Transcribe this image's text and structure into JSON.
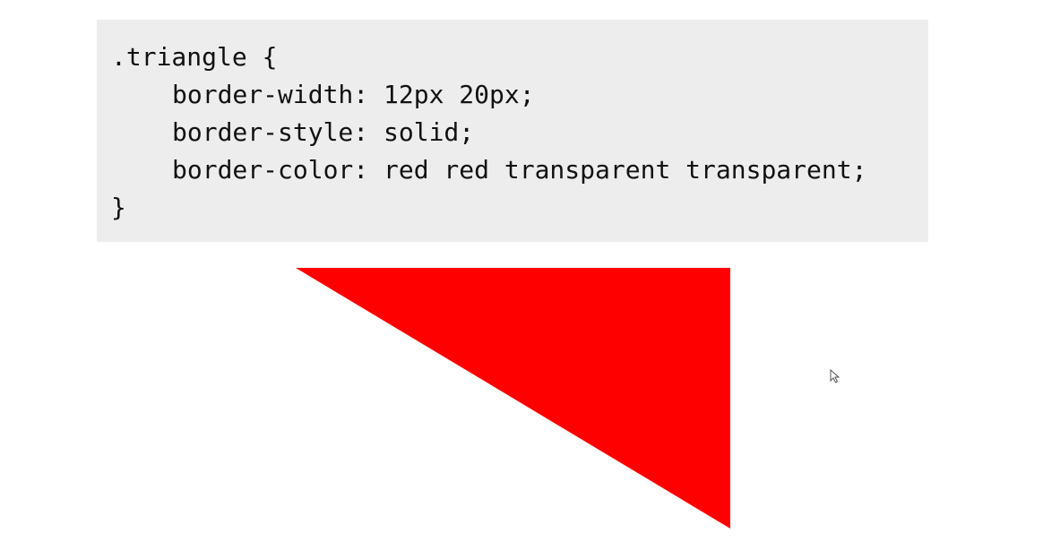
{
  "code": {
    "selector_line": ".triangle {",
    "lines": [
      "border-width: 12px 20px;",
      "border-style: solid;",
      "border-color: red red transparent transparent;"
    ],
    "closing_line": "}"
  },
  "demo": {
    "shape_color": "#ff0000"
  },
  "pointer": {
    "icon": "mouse-pointer-icon"
  }
}
